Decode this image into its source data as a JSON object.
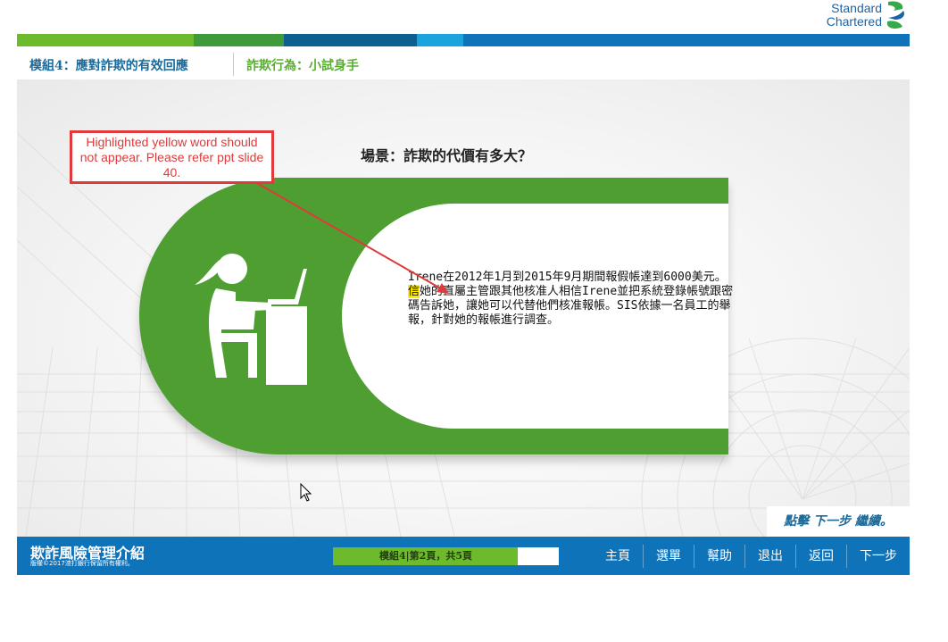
{
  "brand": {
    "line1": "Standard",
    "line2": "Chartered"
  },
  "header": {
    "module_title": "模組4：應對詐欺的有效回應",
    "section_title": "詐欺行為：小試身手"
  },
  "strip_colors": [
    "#6dbb2c",
    "#3f9a3c",
    "#0c5f8f",
    "#1aa3dc",
    "#0f73ba"
  ],
  "scene": {
    "title": "場景：詐欺的代價有多大？",
    "text_before": "Irene在2012年1月到2015年9月期間報假帳達到6000美元。",
    "text_highlight": "信",
    "text_after": "她的直屬主管跟其他核准人相信Irene並把系統登錄帳號跟密碼告訴她，讓她可以代替他們核准報帳。SIS依據一名員工的舉報，針對她的報帳進行調查。",
    "highlight_color": "#ffea00"
  },
  "review_note": "Highlighted yellow word should not appear. Please refer ppt slide 40.",
  "next_hint": "點擊 下一步 繼續。",
  "footer": {
    "course_title": "欺詐風險管理介紹",
    "copyright": "版權©2017渣打銀行保留所有權利。",
    "progress_label": "模組4|第2頁，共5頁",
    "progress_fraction": 0.82,
    "nav": [
      "主頁",
      "選單",
      "幫助",
      "退出",
      "返回",
      "下一步"
    ]
  },
  "colors": {
    "accent_green": "#4f9e32",
    "accent_blue": "#0f73ba",
    "review_red": "#e03a3a"
  }
}
